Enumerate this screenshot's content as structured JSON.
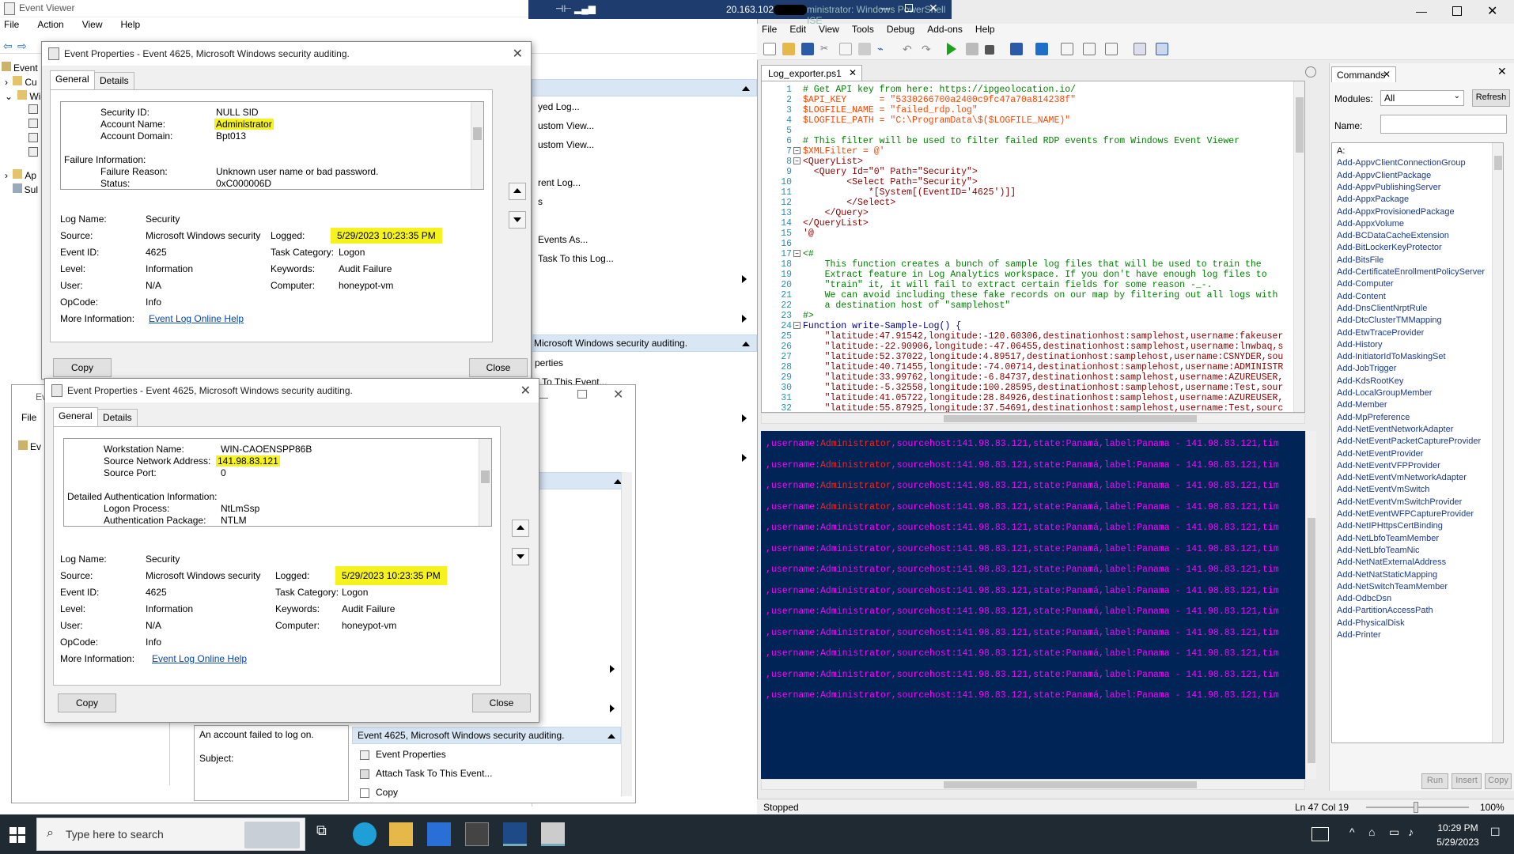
{
  "event_viewer": {
    "title": "Event Viewer",
    "menu": [
      "File",
      "Action",
      "View",
      "Help"
    ],
    "tree_labels": [
      "Event",
      "Cu",
      "Wi",
      "Ap",
      "Sul"
    ],
    "actions": {
      "items_top": [
        "yed Log...",
        "ustom View...",
        "ustom View...",
        "rent Log...",
        "s",
        "Events As...",
        "Task To this Log..."
      ],
      "section_event": "Microsoft Windows security auditing.",
      "items_event": [
        "perties",
        "k To This Event..."
      ],
      "bottom_section": "Event 4625, Microsoft Windows security auditing.",
      "bottom_items": [
        "Event Properties",
        "Attach Task To This Event...",
        "Copy"
      ]
    },
    "mini_window": {
      "title": "Ev",
      "menu": [
        "File",
        "Help"
      ],
      "tree": [
        "Ev"
      ]
    },
    "preview": {
      "text": "An account failed to log on.",
      "subject": "Subject:"
    }
  },
  "dialog1": {
    "title": "Event Properties - Event 4625, Microsoft Windows security auditing.",
    "tabs": [
      "General",
      "Details"
    ],
    "details": [
      {
        "label": "Security ID:",
        "value": "NULL SID"
      },
      {
        "label": "Account Name:",
        "value": "Administrator"
      },
      {
        "label": "Account Domain:",
        "value": "Bpt013"
      },
      {
        "label": "Failure Information:",
        "value": ""
      },
      {
        "label": "Failure Reason:",
        "value": "Unknown user name or bad password."
      },
      {
        "label": "Status:",
        "value": "0xC000006D"
      }
    ],
    "fields": {
      "log_name_label": "Log Name:",
      "log_name": "Security",
      "source_label": "Source:",
      "source": "Microsoft Windows security",
      "logged_label": "Logged:",
      "logged": "5/29/2023 10:23:35 PM",
      "event_id_label": "Event ID:",
      "event_id": "4625",
      "task_label": "Task Category:",
      "task": "Logon",
      "level_label": "Level:",
      "level": "Information",
      "keywords_label": "Keywords:",
      "keywords": "Audit Failure",
      "user_label": "User:",
      "user": "N/A",
      "computer_label": "Computer:",
      "computer": "honeypot-vm",
      "opcode_label": "OpCode:",
      "opcode": "Info",
      "more_label": "More Information:",
      "more_link": "Event Log Online Help"
    },
    "copy": "Copy",
    "close": "Close"
  },
  "dialog2": {
    "title": "Event Properties - Event 4625, Microsoft Windows security auditing.",
    "tabs": [
      "General",
      "Details"
    ],
    "details": [
      {
        "label": "Workstation Name:",
        "value": "WIN-CAOENSPP86B"
      },
      {
        "label": "Source Network Address:",
        "value": "141.98.83.121"
      },
      {
        "label": "Source Port:",
        "value": "0"
      },
      {
        "label": "Detailed Authentication Information:",
        "value": ""
      },
      {
        "label": "Logon Process:",
        "value": "NtLmSsp"
      },
      {
        "label": "Authentication Package:",
        "value": "NTLM"
      }
    ],
    "fields": {
      "log_name_label": "Log Name:",
      "log_name": "Security",
      "source_label": "Source:",
      "source": "Microsoft Windows security",
      "logged_label": "Logged:",
      "logged": "5/29/2023 10:23:35 PM",
      "event_id_label": "Event ID:",
      "event_id": "4625",
      "task_label": "Task Category:",
      "task": "Logon",
      "level_label": "Level:",
      "level": "Information",
      "keywords_label": "Keywords:",
      "keywords": "Audit Failure",
      "user_label": "User:",
      "user": "N/A",
      "computer_label": "Computer:",
      "computer": "honeypot-vm",
      "opcode_label": "OpCode:",
      "opcode": "Info",
      "more_label": "More Information:",
      "more_link": "Event Log Online Help"
    },
    "copy": "Copy",
    "close": "Close"
  },
  "rdp_bar": {
    "ip": "20.163.102.",
    "title_fragment": "ministrator: Windows PowerShell ISE"
  },
  "ise": {
    "menu": [
      "File",
      "Edit",
      "View",
      "Tools",
      "Debug",
      "Add-ons",
      "Help"
    ],
    "tab": "Log_exporter.ps1",
    "code": [
      {
        "n": "1",
        "t": "# Get API key from here: https://ipgeolocation.io/",
        "c": "com"
      },
      {
        "n": "2",
        "t": "$API_KEY      = \"5330266700a2400c9fc47a70a814238f\"",
        "c": "var"
      },
      {
        "n": "3",
        "t": "$LOGFILE_NAME = \"failed_rdp.log\"",
        "c": "var"
      },
      {
        "n": "4",
        "t": "$LOGFILE_PATH = \"C:\\ProgramData\\$($LOGFILE_NAME)\"",
        "c": "var"
      },
      {
        "n": "5",
        "t": "",
        "c": "def"
      },
      {
        "n": "6",
        "t": "# This filter will be used to filter failed RDP events from Windows Event Viewer",
        "c": "com"
      },
      {
        "n": "7",
        "t": "$XMLFilter = @'",
        "c": "var"
      },
      {
        "n": "8",
        "t": "<QueryList>",
        "c": "str"
      },
      {
        "n": "9",
        "t": "  <Query Id=\"0\" Path=\"Security\">",
        "c": "str"
      },
      {
        "n": "10",
        "t": "        <Select Path=\"Security\">",
        "c": "str"
      },
      {
        "n": "11",
        "t": "            *[System[(EventID='4625')]]",
        "c": "str"
      },
      {
        "n": "12",
        "t": "        </Select>",
        "c": "str"
      },
      {
        "n": "13",
        "t": "    </Query>",
        "c": "str"
      },
      {
        "n": "14",
        "t": "</QueryList>",
        "c": "str"
      },
      {
        "n": "15",
        "t": "'@",
        "c": "str"
      },
      {
        "n": "16",
        "t": "",
        "c": "def"
      },
      {
        "n": "17",
        "t": "<#",
        "c": "com"
      },
      {
        "n": "18",
        "t": "    This function creates a bunch of sample log files that will be used to train the",
        "c": "com"
      },
      {
        "n": "19",
        "t": "    Extract feature in Log Analytics workspace. If you don't have enough log files to",
        "c": "com"
      },
      {
        "n": "20",
        "t": "    \"train\" it, it will fail to extract certain fields for some reason -_-.",
        "c": "com"
      },
      {
        "n": "21",
        "t": "    We can avoid including these fake records on our map by filtering out all logs with",
        "c": "com"
      },
      {
        "n": "22",
        "t": "    a destination host of \"samplehost\"",
        "c": "com"
      },
      {
        "n": "23",
        "t": "#>",
        "c": "com"
      },
      {
        "n": "24",
        "t": "Function write-Sample-Log() {",
        "c": "kw"
      },
      {
        "n": "25",
        "t": "    \"latitude:47.91542,longitude:-120.60306,destinationhost:samplehost,username:fakeuser",
        "c": "str"
      },
      {
        "n": "26",
        "t": "    \"latitude:-22.90906,longitude:-47.06455,destinationhost:samplehost,username:lnwbaq,s",
        "c": "str"
      },
      {
        "n": "27",
        "t": "    \"latitude:52.37022,longitude:4.89517,destinationhost:samplehost,username:CSNYDER,sou",
        "c": "str"
      },
      {
        "n": "28",
        "t": "    \"latitude:40.71455,longitude:-74.00714,destinationhost:samplehost,username:ADMINISTR",
        "c": "str"
      },
      {
        "n": "29",
        "t": "    \"latitude:33.99762,longitude:-6.84737,destinationhost:samplehost,username:AZUREUSER,",
        "c": "str"
      },
      {
        "n": "30",
        "t": "    \"latitude:-5.32558,longitude:100.28595,destinationhost:samplehost,username:Test,sour",
        "c": "str"
      },
      {
        "n": "31",
        "t": "    \"latitude:41.05722,longitude:28.84926,destinationhost:samplehost,username:AZUREUSER,",
        "c": "str"
      },
      {
        "n": "32",
        "t": "    \"latitude:55.87925,longitude:37.54691,destinationhost:samplehost,username:Test,sourc",
        "c": "str"
      }
    ],
    "console_lines": [
      {
        "pre": ",username:",
        "user": "Administrator",
        "post": ",sourcehost:141.98.83.121,state:Panamá,label:Panama - 141.98.83.121,tim",
        "hl": true
      },
      {
        "pre": ",username:",
        "user": "Administrator",
        "post": ",sourcehost:141.98.83.121,state:Panamá,label:Panama - 141.98.83.121,tim",
        "hl": true
      },
      {
        "pre": ",username:",
        "user": "Administrator",
        "post": ",sourcehost:141.98.83.121,state:Panamá,label:Panama - 141.98.83.121,tim",
        "hl": true
      },
      {
        "pre": ",username:",
        "user": "Administrator",
        "post": ",sourcehost:141.98.83.121,state:Panamá,label:Panama - 141.98.83.121,tim",
        "hl": true
      },
      {
        "pre": ",username:",
        "user": "Administrator",
        "post": ",sourcehost:141.98.83.121,state:Panamá,label:Panama - 141.98.83.121,tim",
        "hl": false
      },
      {
        "pre": ",username:",
        "user": "Administrator",
        "post": ",sourcehost:141.98.83.121,state:Panamá,label:Panama - 141.98.83.121,tim",
        "hl": false
      },
      {
        "pre": ",username:",
        "user": "Administrator",
        "post": ",sourcehost:141.98.83.121,state:Panamá,label:Panama - 141.98.83.121,tim",
        "hl": false
      },
      {
        "pre": ",username:",
        "user": "Administrator",
        "post": ",sourcehost:141.98.83.121,state:Panamá,label:Panama - 141.98.83.121,tim",
        "hl": false
      },
      {
        "pre": ",username:",
        "user": "Administrator",
        "post": ",sourcehost:141.98.83.121,state:Panamá,label:Panama - 141.98.83.121,tim",
        "hl": false
      },
      {
        "pre": ",username:",
        "user": "Administrator",
        "post": ",sourcehost:141.98.83.121,state:Panamá,label:Panama - 141.98.83.121,tim",
        "hl": false
      },
      {
        "pre": ",username:",
        "user": "Administrator",
        "post": ",sourcehost:141.98.83.121,state:Panamá,label:Panama - 141.98.83.121,tim",
        "hl": false
      },
      {
        "pre": ",username:",
        "user": "Administrator",
        "post": ",sourcehost:141.98.83.121,state:Panamá,label:Panama - 141.98.83.121,tim",
        "hl": false
      },
      {
        "pre": ",username:",
        "user": "Administrator",
        "post": ",sourcehost:141.98.83.121,state:Panamá,label:Panama - 141.98.83.121,tim",
        "hl": false
      }
    ],
    "commands": {
      "title": "Commands",
      "modules_label": "Modules:",
      "modules_value": "All",
      "refresh": "Refresh",
      "name_label": "Name:",
      "items": [
        "A:",
        "Add-AppvClientConnectionGroup",
        "Add-AppvClientPackage",
        "Add-AppvPublishingServer",
        "Add-AppxPackage",
        "Add-AppxProvisionedPackage",
        "Add-AppxVolume",
        "Add-BCDataCacheExtension",
        "Add-BitLockerKeyProtector",
        "Add-BitsFile",
        "Add-CertificateEnrollmentPolicyServer",
        "Add-Computer",
        "Add-Content",
        "Add-DnsClientNrptRule",
        "Add-DtcClusterTMMapping",
        "Add-EtwTraceProvider",
        "Add-History",
        "Add-InitiatorIdToMaskingSet",
        "Add-JobTrigger",
        "Add-KdsRootKey",
        "Add-LocalGroupMember",
        "Add-Member",
        "Add-MpPreference",
        "Add-NetEventNetworkAdapter",
        "Add-NetEventPacketCaptureProvider",
        "Add-NetEventProvider",
        "Add-NetEventVFPProvider",
        "Add-NetEventVmNetworkAdapter",
        "Add-NetEventVmSwitch",
        "Add-NetEventVmSwitchProvider",
        "Add-NetEventWFPCaptureProvider",
        "Add-NetIPHttpsCertBinding",
        "Add-NetLbfoTeamMember",
        "Add-NetLbfoTeamNic",
        "Add-NetNatExternalAddress",
        "Add-NetNatStaticMapping",
        "Add-NetSwitchTeamMember",
        "Add-OdbcDsn",
        "Add-PartitionAccessPath",
        "Add-PhysicalDisk",
        "Add-Printer"
      ],
      "run": "Run",
      "insert": "Insert",
      "copy": "Copy"
    },
    "status": {
      "state": "Stopped",
      "position": "Ln 47  Col 19",
      "zoom": "100%"
    }
  },
  "taskbar": {
    "search_placeholder": "Type here to search",
    "time": "10:29 PM",
    "date": "5/29/2023"
  }
}
